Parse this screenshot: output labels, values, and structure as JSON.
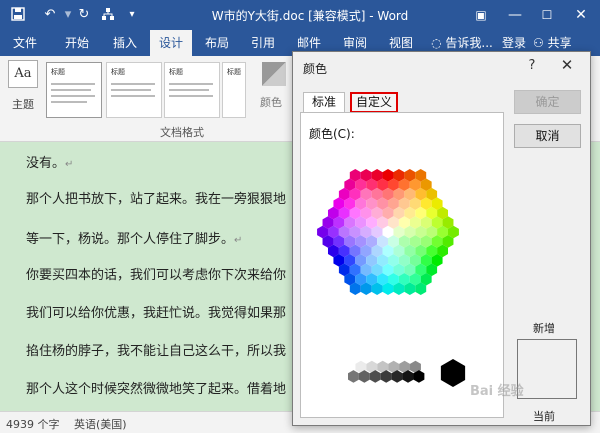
{
  "titlebar": {
    "document_title": "W市的Y大街.doc [兼容模式] - Word",
    "icons": [
      "save-icon",
      "undo-icon",
      "redo-icon",
      "customize-qat-icon"
    ],
    "window_controls": [
      "ribbon-display-icon",
      "minimize-icon",
      "maximize-icon",
      "close-icon"
    ]
  },
  "ribbon": {
    "tabs": [
      "文件",
      "开始",
      "插入",
      "设计",
      "布局",
      "引用",
      "邮件",
      "审阅",
      "视图"
    ],
    "active_tab": "设计",
    "tell_me": "告诉我...",
    "login": "登录",
    "share": "共享",
    "theme_label": "主题",
    "theme_glyph": "Aa",
    "gallery_titles": [
      "标题",
      "标题",
      "标题"
    ],
    "gallery_first_title": "标题",
    "group_label": "文档格式",
    "colors_label": "颜色"
  },
  "document": {
    "paragraphs": [
      "没有。",
      "那个人把书放下，站了起来。我在一旁狠狠地",
      "等一下，杨说。那个人停住了脚步。",
      "你要买四本的话，我们可以考虑你下次来给你",
      "我们可以给你优惠，我赶忙说。我觉得如果那",
      "掐住杨的脖子，我不能让自己这么干，所以我",
      "那个人这个时候突然微微地笑了起来。借着地"
    ],
    "para_mark": "↵"
  },
  "statusbar": {
    "word_count": "4939 个字",
    "language": "英语(美国)"
  },
  "dialog": {
    "title": "颜色",
    "help": "?",
    "tabs": {
      "standard": "标准",
      "custom": "自定义"
    },
    "colors_label": "颜色(C):",
    "ok_button": "确定",
    "cancel_button": "取消",
    "new_label": "新增",
    "current_label": "当前",
    "highlight_color": "#e00000"
  },
  "watermark": "Bai 经验"
}
